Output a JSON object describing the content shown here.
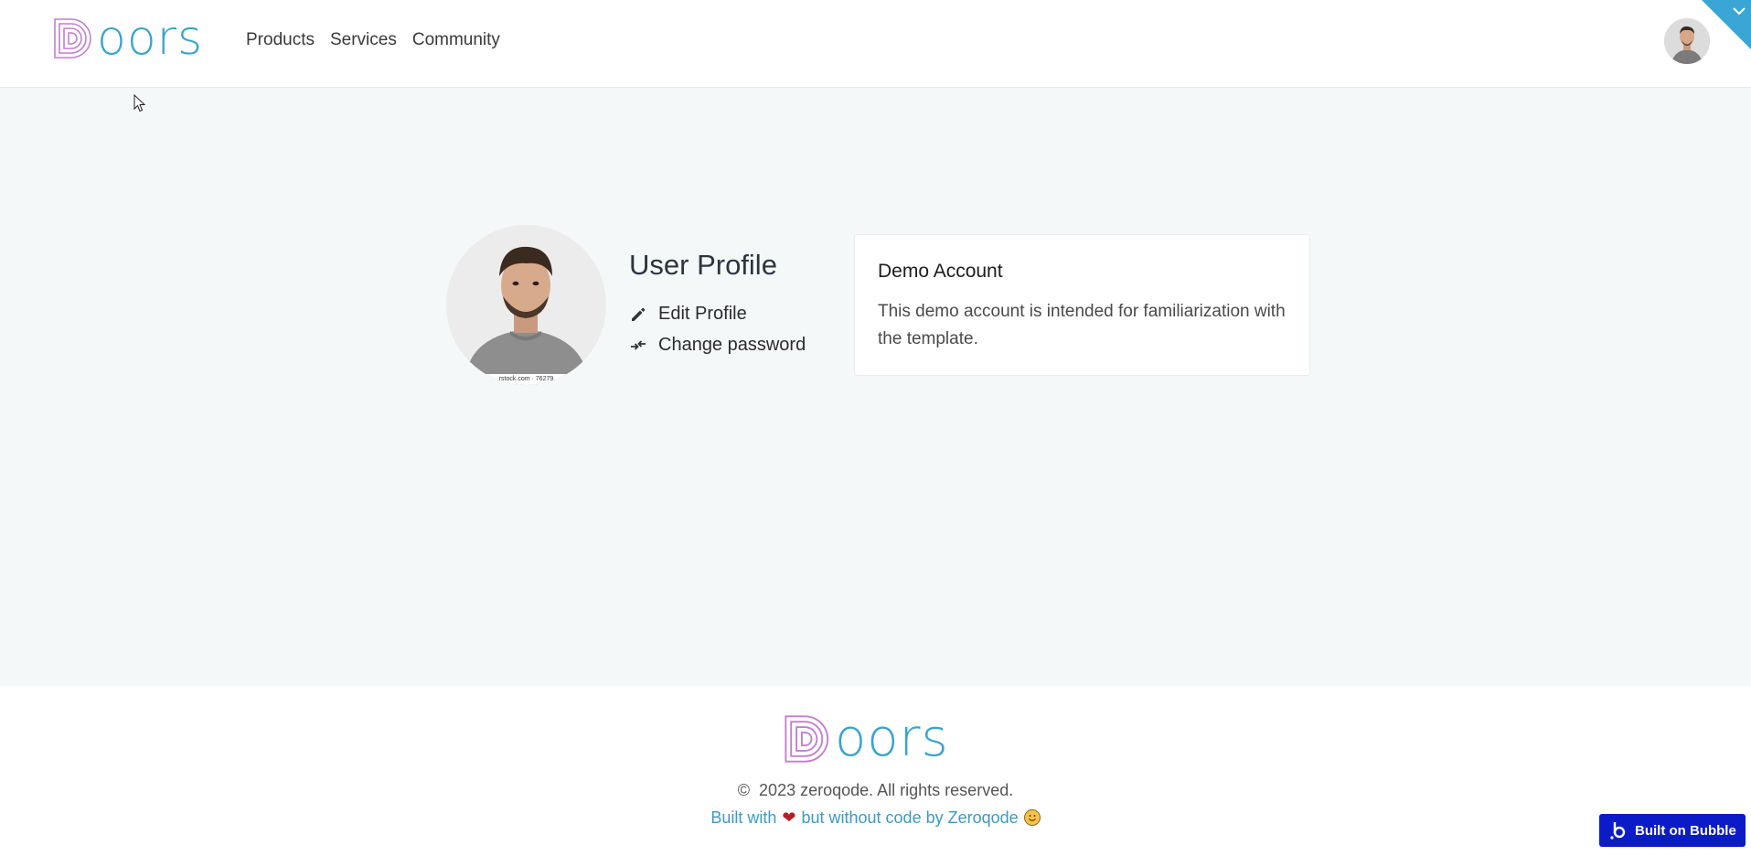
{
  "brand": {
    "name": "oors",
    "initial": "D"
  },
  "nav": {
    "items": [
      "Products",
      "Services",
      "Community"
    ]
  },
  "profile": {
    "title": "User Profile",
    "photo_caption": "...rstock.com · 76279...",
    "actions": {
      "edit": "Edit Profile",
      "password": "Change password"
    }
  },
  "card": {
    "title": "Demo Account",
    "text": "This demo account is intended for familiarization with the template."
  },
  "footer": {
    "copyright": "©  2023 zeroqode. All rights reserved.",
    "built_prefix": "Built with",
    "built_suffix": "but without code by Zeroqode"
  },
  "badge": {
    "label": "Built on Bubble"
  },
  "colors": {
    "brand_blue": "#37a3d0",
    "logo_purple": "#c27fd1",
    "page_bg": "#f5f8f9",
    "bubble_blue": "#0b1bc7",
    "heart": "#b51e24"
  },
  "icons": [
    "pencil-icon",
    "password-arrows-icon",
    "chevron-down-icon",
    "heart-icon",
    "smile-icon",
    "bubble-logo-icon",
    "mouse-cursor-icon"
  ]
}
